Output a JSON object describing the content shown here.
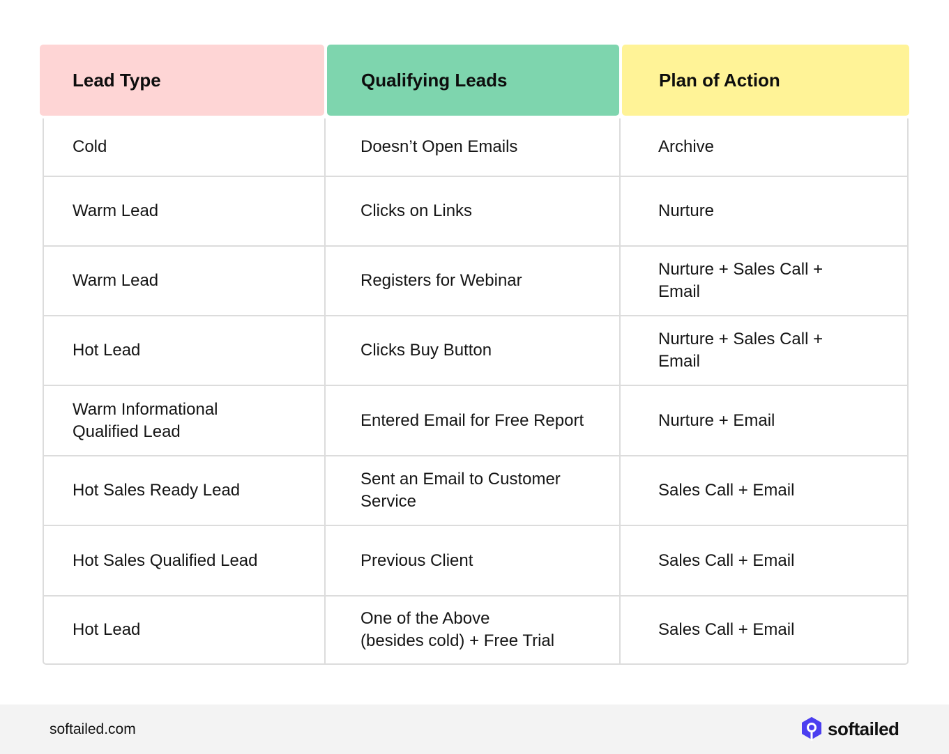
{
  "table": {
    "headers": [
      {
        "label": "Lead Type",
        "color": "#fed5d5"
      },
      {
        "label": "Qualifying Leads",
        "color": "#7ed5ae"
      },
      {
        "label": "Plan of Action",
        "color": "#fff397"
      }
    ],
    "rows": [
      [
        "Cold",
        "Doesn’t Open Emails",
        "Archive"
      ],
      [
        "Warm Lead",
        "Clicks on Links",
        "Nurture"
      ],
      [
        "Warm Lead",
        "Registers for Webinar",
        "Nurture + Sales Call + Email"
      ],
      [
        "Hot Lead",
        "Clicks Buy Button",
        "Nurture + Sales Call + Email"
      ],
      [
        "Warm Informational Qualified Lead",
        "Entered Email for Free Report",
        "Nurture + Email"
      ],
      [
        "Hot Sales Ready Lead",
        "Sent an Email to Customer Service",
        "Sales Call + Email"
      ],
      [
        "Hot Sales Qualified Lead",
        "Previous Client",
        "Sales Call + Email"
      ],
      [
        "Hot Lead",
        "One of the Above\n(besides cold) + Free Trial",
        "Sales Call + Email"
      ]
    ]
  },
  "footer": {
    "url": "softailed.com",
    "brand": "softailed",
    "brand_icon": "hexagon-magnifier-icon",
    "brand_color": "#4b3ef0"
  }
}
